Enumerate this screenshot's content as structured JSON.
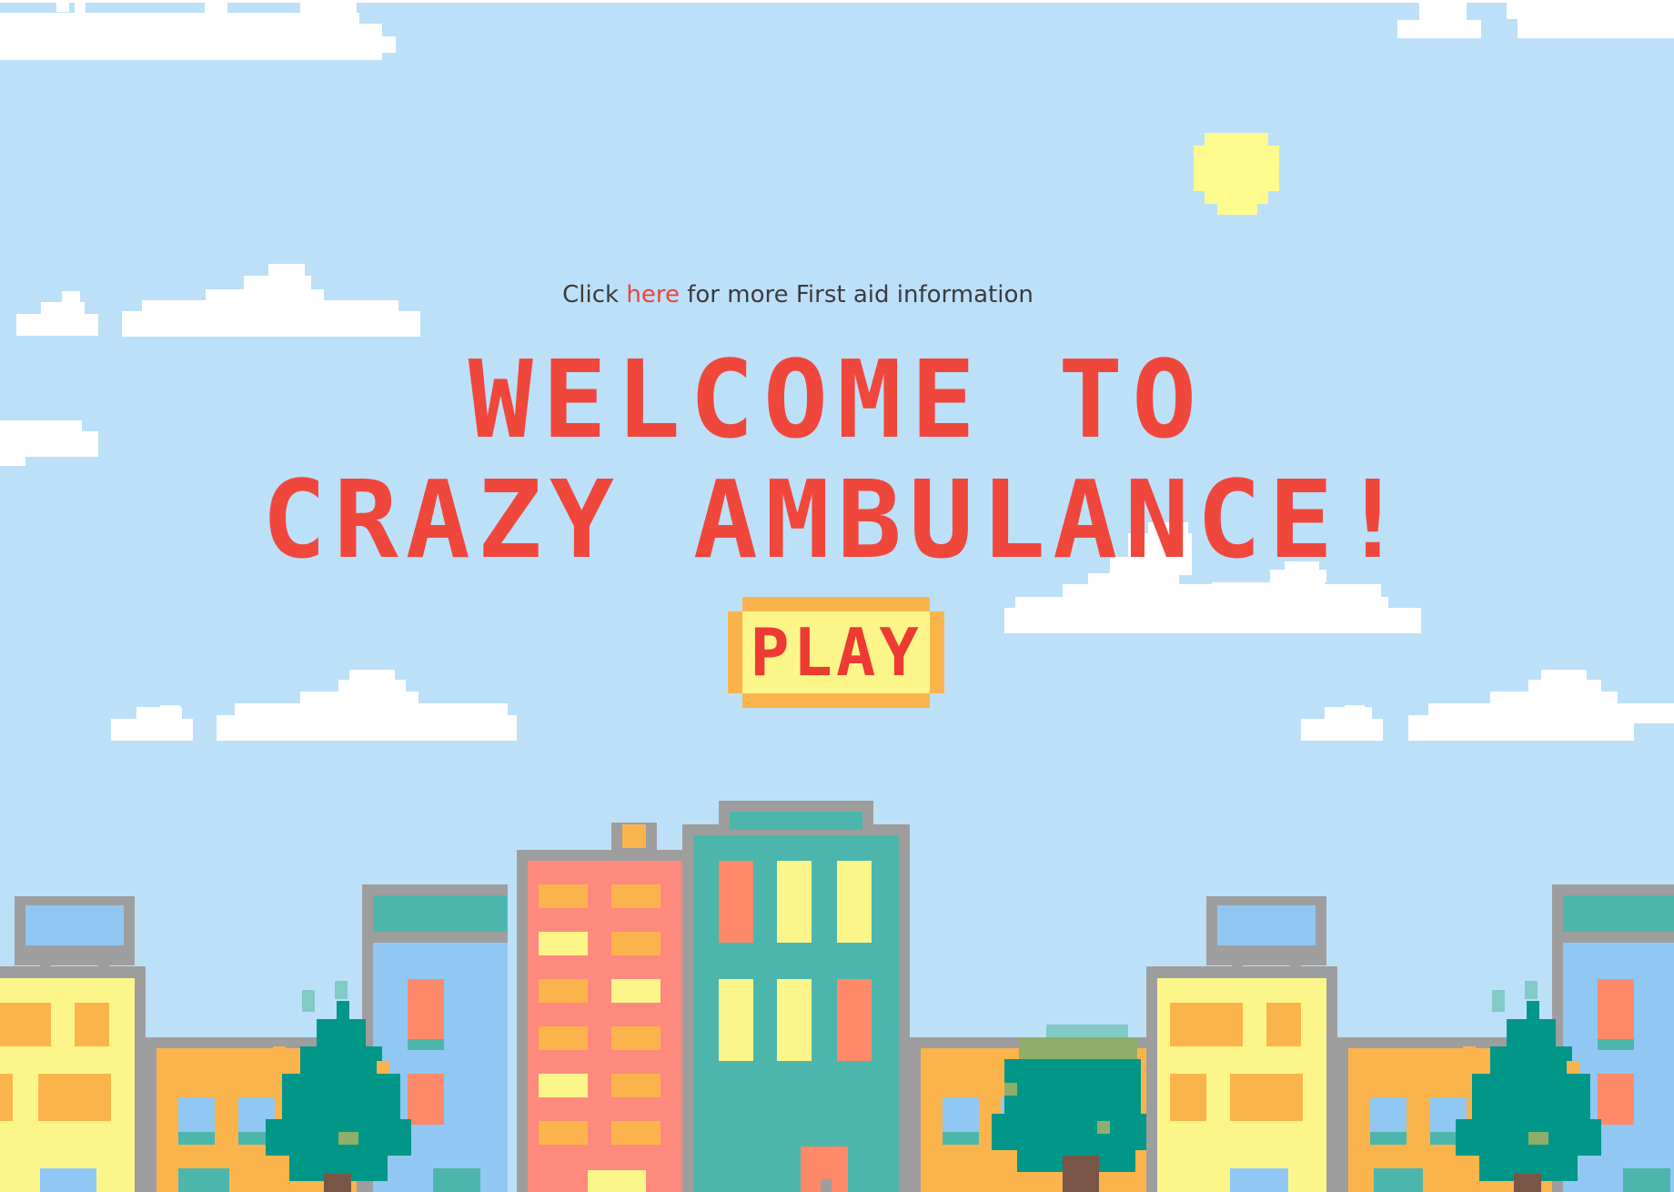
{
  "info": {
    "prefix": "Click ",
    "link": "here",
    "suffix": " for more First aid information"
  },
  "title": {
    "line1": "WELCOME TO",
    "line2": "CRAZY AMBULANCE!"
  },
  "play": {
    "label": "PLAY"
  },
  "colors": {
    "sky": "#bde0f9",
    "title": "#f0473c",
    "link": "#e8473a",
    "button_fill": "#fcf68a",
    "button_border": "#fbb44c",
    "sun": "#fdfb8e"
  }
}
